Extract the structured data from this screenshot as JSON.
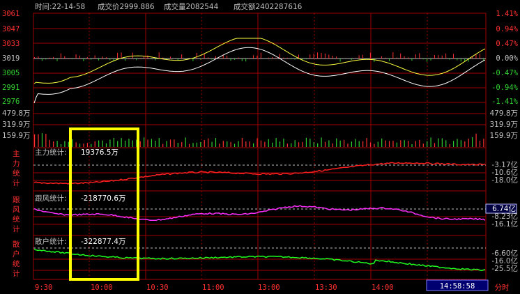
{
  "header": {
    "time": "时间:22-14-58",
    "price": "成交价2999.886",
    "volume": "成交量2082544",
    "amount": "成交额2402287616"
  },
  "price_axis": {
    "left_labels": [
      "3061",
      "3047",
      "3033",
      "3019",
      "3005",
      "2991",
      "2976"
    ],
    "right_labels": [
      "1.41%",
      "0.94%",
      "0.47%",
      "0.00%",
      "-0.47%",
      "-0.94%",
      "-1.41%"
    ]
  },
  "volume_axis": {
    "labels": [
      "479.8万",
      "319.9万",
      "159.9万"
    ]
  },
  "panels": {
    "main_force": {
      "side_label": [
        "主",
        "力",
        "统",
        "计"
      ],
      "title": "主力统计:",
      "value": "19376.5万",
      "right_labels": [
        "-3.17亿",
        "-10.6亿",
        "-18.0亿"
      ],
      "line_color": "#ff2020"
    },
    "follow": {
      "side_label": [
        "跟",
        "风",
        "统",
        "计"
      ],
      "title": "跟风统计:",
      "value": "-218770.6万",
      "right_labels": [
        "6.74亿",
        "-8.23亿",
        "-16.1亿"
      ],
      "line_color": "#ff30ff"
    },
    "retail": {
      "side_label": [
        "散",
        "户",
        "统",
        "计"
      ],
      "title": "散户统计:",
      "value": "-322877.4万",
      "right_labels": [
        "-6.60亿",
        "-16.0亿",
        "-25.5亿"
      ],
      "line_color": "#20ff20"
    }
  },
  "time_axis": {
    "labels": [
      "9:30",
      "10:00",
      "10:30",
      "11:00",
      "13:00",
      "13:30",
      "14:00"
    ],
    "current_time": "14:58:58",
    "mode_button": "分时"
  },
  "colors": {
    "grid": "#a00000",
    "price_line": "#ffffff",
    "avg_line": "#ffff40",
    "up": "#ff3030",
    "down": "#30d030",
    "highlight_box": "#ffff00"
  }
}
